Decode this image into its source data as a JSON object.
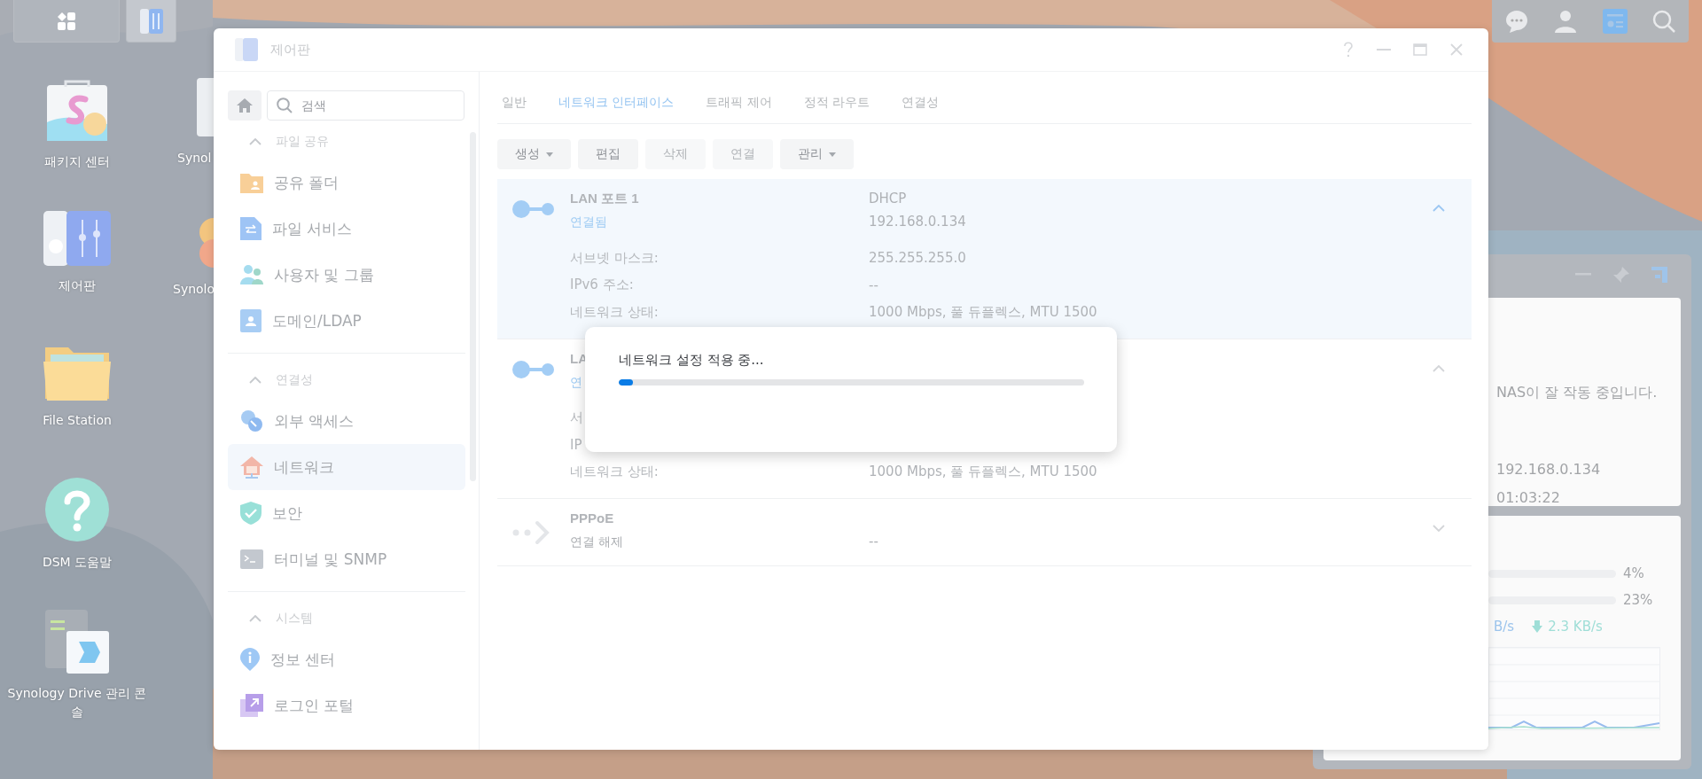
{
  "taskbar": [
    {
      "kind": "launcher",
      "selected": false
    },
    {
      "kind": "control-panel",
      "selected": true
    }
  ],
  "tray": [
    {
      "kind": "chat",
      "selected": false
    },
    {
      "kind": "user",
      "selected": false
    },
    {
      "kind": "widgets",
      "selected": true
    },
    {
      "kind": "search",
      "selected": false
    }
  ],
  "desktop_icons": [
    {
      "label": "패키지 센터",
      "kind": "package"
    },
    {
      "label": "제어판",
      "kind": "control-panel"
    },
    {
      "label": "File Station",
      "kind": "folder"
    },
    {
      "label": "DSM 도움말",
      "kind": "help"
    },
    {
      "label": "Synology Drive 관리 콘솔",
      "kind": "drive"
    }
  ],
  "desktop_icons_partial": [
    {
      "label": "Synol",
      "kind": "box"
    },
    {
      "label": "Synolo",
      "kind": "circles"
    }
  ],
  "window": {
    "title": "제어판",
    "controls": [
      {
        "kind": "help"
      },
      {
        "kind": "minimize"
      },
      {
        "kind": "maximize"
      },
      {
        "kind": "close"
      }
    ]
  },
  "sidebar": {
    "search": {
      "placeholder": "검색"
    },
    "sections": [
      {
        "title": "파일 공유",
        "expanded": true,
        "items": [
          {
            "label": "공유 폴더",
            "kind": "shared-folder",
            "selected": false
          },
          {
            "label": "파일 서비스",
            "kind": "file-services",
            "selected": false
          },
          {
            "label": "사용자 및 그룹",
            "kind": "users",
            "selected": false
          },
          {
            "label": "도메인/LDAP",
            "kind": "domain",
            "selected": false
          }
        ]
      },
      {
        "title": "연결성",
        "expanded": true,
        "items": [
          {
            "label": "외부 액세스",
            "kind": "external-access",
            "selected": false
          },
          {
            "label": "네트워크",
            "kind": "network",
            "selected": true
          },
          {
            "label": "보안",
            "kind": "security",
            "selected": false
          },
          {
            "label": "터미널 및 SNMP",
            "kind": "terminal",
            "selected": false
          }
        ]
      },
      {
        "title": "시스템",
        "expanded": true,
        "items": [
          {
            "label": "정보 센터",
            "kind": "info",
            "selected": false
          },
          {
            "label": "로그인 포털",
            "kind": "login-portal",
            "selected": false
          }
        ]
      }
    ]
  },
  "tabs": [
    {
      "label": "일반",
      "selected": false
    },
    {
      "label": "네트워크 인터페이스",
      "selected": true
    },
    {
      "label": "트래픽 제어",
      "selected": false
    },
    {
      "label": "정적 라우트",
      "selected": false
    },
    {
      "label": "연결성",
      "selected": false
    }
  ],
  "toolbar": [
    {
      "label": "생성",
      "dropdown": true,
      "disabled": false
    },
    {
      "label": "편집",
      "dropdown": false,
      "disabled": false
    },
    {
      "label": "삭제",
      "dropdown": false,
      "disabled": true
    },
    {
      "label": "연결",
      "dropdown": false,
      "disabled": true
    },
    {
      "label": "관리",
      "dropdown": true,
      "disabled": false
    }
  ],
  "interfaces": [
    {
      "kind": "lan",
      "name": "LAN 포트 1",
      "status": "연결됨",
      "connected": true,
      "selected": true,
      "expanded": true,
      "mode": "DHCP",
      "ip": "192.168.0.134",
      "details": [
        {
          "label": "서브넷 마스크:",
          "value": "255.255.255.0"
        },
        {
          "label": "IPv6 주소:",
          "value": "--"
        },
        {
          "label": "네트워크 상태:",
          "value": "1000 Mbps, 풀 듀플렉스, MTU 1500"
        }
      ]
    },
    {
      "kind": "lan",
      "name": "LA",
      "status": "연",
      "connected": true,
      "selected": false,
      "expanded": true,
      "details": [
        {
          "label": "서"
        },
        {
          "label": "IP"
        },
        {
          "label": "네트워크 상태:",
          "value": "1000 Mbps, 풀 듀플렉스, MTU 1500"
        }
      ]
    },
    {
      "kind": "pppoe",
      "name": "PPPoE",
      "status": "연결 해제",
      "connected": false,
      "selected": false,
      "expanded": false,
      "ip": "--"
    }
  ],
  "dialog": {
    "message": "네트워크 설정 적용 중...",
    "level": 0.03
  },
  "widget": {
    "status_text": "NAS이 잘 작동 중입니다.",
    "ip": "192.168.0.134",
    "uptime": "01:03:22",
    "meters": [
      {
        "reading": "4%"
      },
      {
        "reading": "23%"
      }
    ],
    "upload": "B/s",
    "download": "2.3 KB/s"
  }
}
